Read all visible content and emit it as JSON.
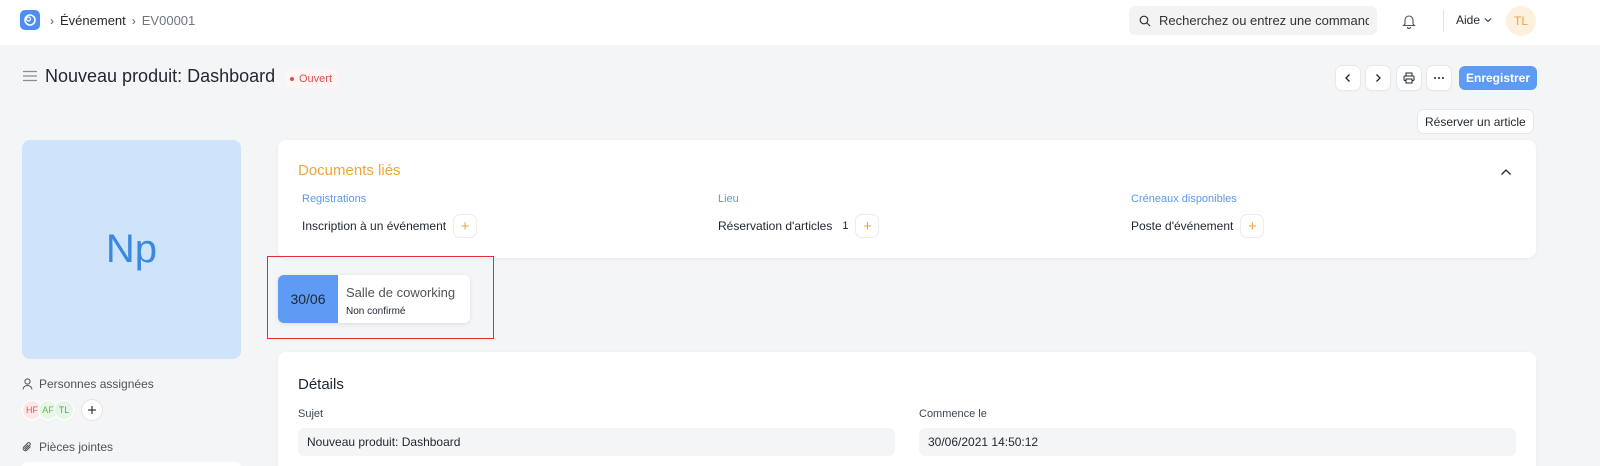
{
  "navbar": {
    "breadcrumbs": [
      "Événement",
      "EV00001"
    ],
    "search_placeholder": "Recherchez ou entrez une commande",
    "help_label": "Aide",
    "user_initials": "TL"
  },
  "page": {
    "title": "Nouveau produit: Dashboard",
    "status": "Ouvert",
    "save_label": "Enregistrer",
    "reserve_label": "Réserver un article"
  },
  "sidebar": {
    "image_initials": "Np",
    "assigned_label": "Personnes assignées",
    "assignees": [
      "HF",
      "AF",
      "TL"
    ],
    "attachments_label": "Pièces jointes"
  },
  "linked_documents": {
    "title": "Documents liés",
    "groups": [
      {
        "category": "Registrations",
        "doc": "Inscription à un événement",
        "count": ""
      },
      {
        "category": "Lieu",
        "doc": "Réservation d'articles",
        "count": "1"
      },
      {
        "category": "Créneaux disponibles",
        "doc": "Poste d'événement",
        "count": ""
      }
    ]
  },
  "slot": {
    "date": "30/06",
    "title": "Salle de coworking",
    "status": "Non confirmé"
  },
  "details": {
    "title": "Détails",
    "fields": [
      {
        "label": "Sujet",
        "value": "Nouveau produit: Dashboard"
      },
      {
        "label": "Commence le",
        "value": "30/06/2021 14:50:12"
      }
    ]
  },
  "colors": {
    "primary": "#5e9bf5",
    "accent_orange": "#f0a63a",
    "status_red": "#e24c4c",
    "highlight_outline": "#e8292f"
  }
}
